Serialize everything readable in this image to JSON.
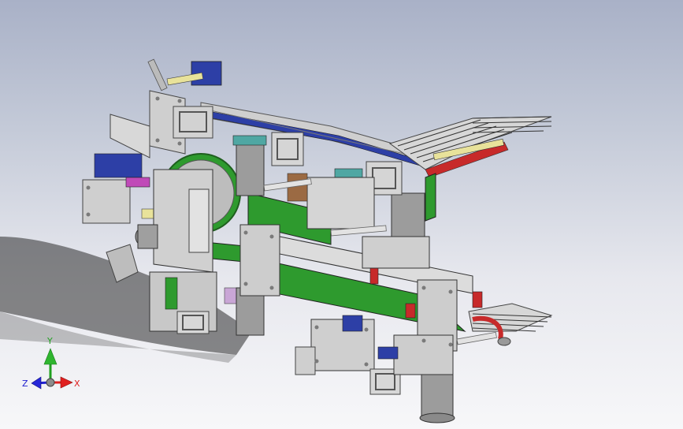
{
  "scene": {
    "colors": {
      "steel_light": "#c9c9c9",
      "steel_mid": "#a9a9a9",
      "steel_dark": "#6e6e6e",
      "green_plate": "#2e9a2e",
      "teal_cyl": "#4fa7a3",
      "blue_part": "#2d3fa6",
      "red_part": "#c72a2a",
      "yellow_rod": "#e8e29a",
      "brown_block": "#9b6a43",
      "magenta_part": "#c04ab8"
    }
  },
  "triad": {
    "x_label": "X",
    "y_label": "Y",
    "z_label": "Z",
    "x_color": "#e02020",
    "y_color": "#20a020",
    "z_color": "#2020d0"
  }
}
